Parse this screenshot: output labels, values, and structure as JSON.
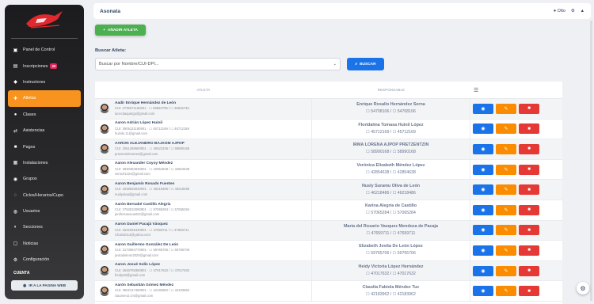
{
  "topbar": {
    "title": "Asonata",
    "user": "Otto"
  },
  "sidebar": {
    "items": [
      {
        "label": "Panel de Control",
        "icon": "monitor-icon",
        "glyph": "▣"
      },
      {
        "label": "Inscripciones",
        "icon": "calendar-icon",
        "glyph": "▤",
        "badge": "20"
      },
      {
        "label": "Instructores",
        "icon": "whistle-icon",
        "glyph": "◆"
      },
      {
        "label": "Atletas",
        "icon": "runner-icon",
        "glyph": "✚",
        "active": true
      },
      {
        "label": "Clases",
        "icon": "group-icon",
        "glyph": "●"
      },
      {
        "label": "Asistencias",
        "icon": "shuffle-icon",
        "glyph": "⇄"
      },
      {
        "label": "Pagos",
        "icon": "truck-icon",
        "glyph": "■"
      },
      {
        "label": "Instalaciones",
        "icon": "building-icon",
        "glyph": "▦"
      },
      {
        "label": "Grupos",
        "icon": "globe-icon",
        "glyph": "◉"
      },
      {
        "label": "Ciclos/Horarios/Cupo",
        "icon": "cycle-icon",
        "glyph": "◌"
      },
      {
        "label": "Usuarios",
        "icon": "users-icon",
        "glyph": "◍"
      },
      {
        "label": "Secciones",
        "icon": "sections-icon",
        "glyph": "◐"
      },
      {
        "label": "Noticias",
        "icon": "news-icon",
        "glyph": "▢"
      },
      {
        "label": "Configuración",
        "icon": "gear-icon",
        "glyph": "⚙"
      }
    ],
    "cuenta": "CUENTA",
    "web_button": "IR A LA PAGINA WEB"
  },
  "toolbar": {
    "add_label": "AÑADIR ATLETA"
  },
  "search": {
    "label": "Buscar Atleta:",
    "placeholder": "Buscar por Nombre/CUI-DPI...",
    "button": "BUSCAR"
  },
  "table": {
    "headers": {
      "athlete": "ATLETA",
      "responsible": "RESPONSABLE",
      "options": "☰"
    },
    "rows": [
      {
        "name": "Aadir Enrique Hernández de León",
        "cui": "CUI: 3735571150901 · ☐ 58583795 / ☐ 36625745",
        "email": "lucecitaquetgo@gmail.com",
        "resp": "Enrique Rosalío Hernández Serna",
        "tel": "☐ 54708106 / ☐ 54708106"
      },
      {
        "name": "Aaron Adrián López Huinil",
        "cui": "CUI: 3905131180901 · ☐ 45712169 / ☐ 45712169",
        "email": "huinilo.11@gmail.com",
        "resp": "Floridalma Tomasa Huinil López",
        "tel": "☐ 45712169 / ☐ 45712169"
      },
      {
        "name": "AARON ALEJANDRO BAJXOM AJPOP",
        "cui": "CUI: 2051288660901 · ☐ 40622236 / ☐ 58990168",
        "email": "pretzentzintorres@gmail.com",
        "resp": "IRMA LORENA AJPOP PRETZENTZIN",
        "tel": "☐ 58990168 / ☐ 58990168"
      },
      {
        "name": "Aaron Alexander Coyoy Méndez",
        "cui": "CUI: 3930363830901 · ☐ 42854638 / ☐ 42854638",
        "email": "veroizl1324@gmail.com",
        "resp": "Verónica Elizabeth Méndez López",
        "tel": "☐ 42854638 / ☐ 42854638"
      },
      {
        "name": "Aaron Benjamín Rosado Fuentes",
        "cui": "CUI: 4038626040901 · ☐ 46218486 / ☐ 46218486",
        "email": "nuolyolaa@gmail.com",
        "resp": "Nusly Suramu Oliva de León",
        "tel": "☐ 46218486 / ☐ 46218486"
      },
      {
        "name": "Aarón Bernabé Castillo Alegría",
        "cui": "CUI: 2763010090901 · ☐ 57065284 / ☐ 57065284",
        "email": "jenifersanacast22@gmail.com",
        "resp": "Karina Alegría de Castillo",
        "tel": "☐ 57065284 / ☐ 57065284"
      },
      {
        "name": "Aaron Daniel Pacajá Vásquez",
        "cui": "CUI: 2522026420901 · ☐ 47659711 / ☐ 47659711",
        "email": "Chalo2014@yahoo.com",
        "resp": "María del Rosario Vasquez Mendoza de Pacaja",
        "tel": "☐ 47659711 / ☐ 47659711"
      },
      {
        "name": "Aaron Guillermo González De León",
        "cui": "CUI: 3173094770901 · ☐ 59765706 / ☐ 59765706",
        "email": "jovitadeleon2020@gmail.com",
        "resp": "Elizabeth Jovita De León López",
        "tel": "☐ 59765706 / ☐ 59765706"
      },
      {
        "name": "Aaron Josué Solís López",
        "cui": "CUI: 2646708380901 · ☐ 47017632 / ☐ 47017632",
        "email": "freidy93@gmail.com",
        "resp": "Heidy Victoria López Hernández",
        "tel": "☐ 47017632 / ☐ 47017632"
      },
      {
        "name": "Aarón Sebastián Gómez Méndez",
        "cui": "CUI: 3602147480901 · ☐ 42183962 / ☐ 42183962",
        "email": "claumen2.cm@gmail.com",
        "resp": "Claudia Fabiola Méndez Tuc",
        "tel": "☐ 42183962 / ☐ 42183962"
      }
    ]
  },
  "colors": {
    "accent": "#f7931e",
    "primary": "#1a73e8",
    "success": "#4caf50",
    "danger": "#e53935",
    "warning": "#fb8c00"
  }
}
